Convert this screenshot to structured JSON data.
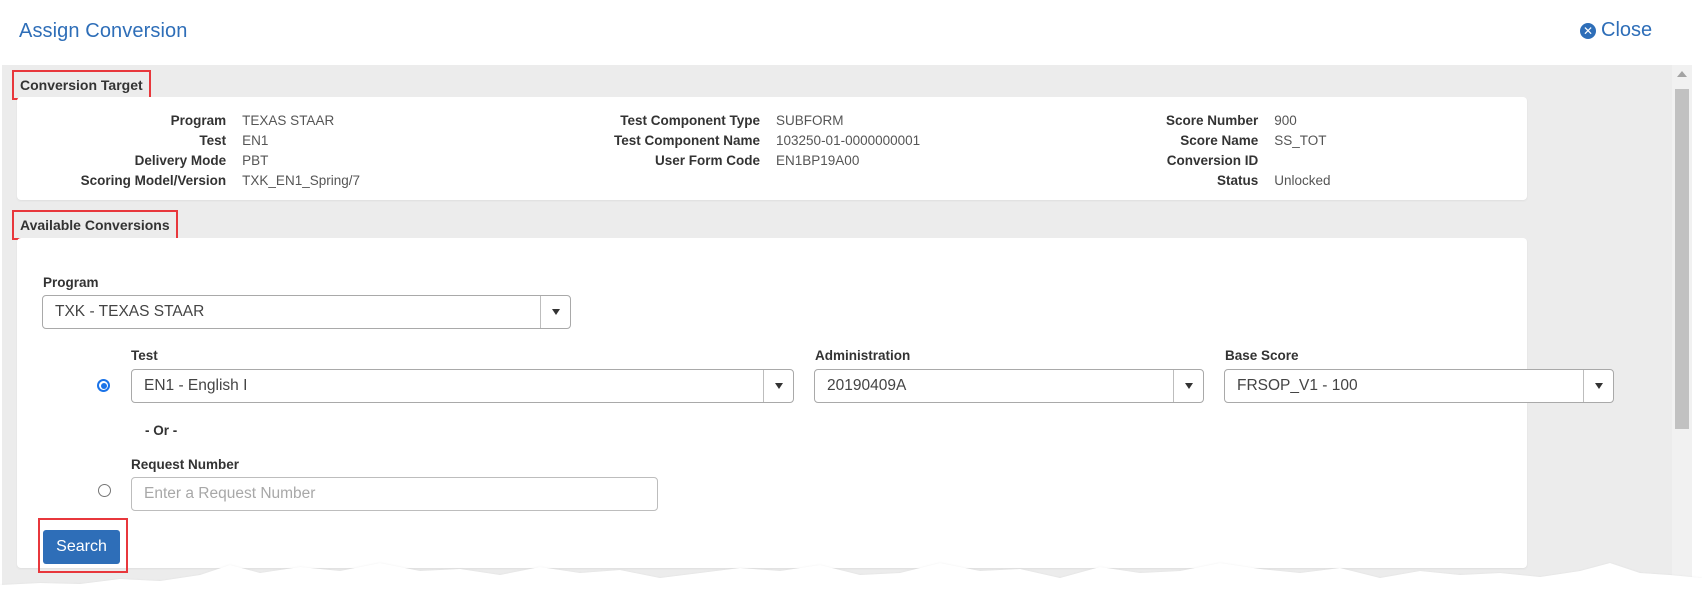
{
  "header": {
    "title": "Assign Conversion",
    "close_label": "Close",
    "close_icon": "circle-x-icon"
  },
  "colors": {
    "accent": "#2e6eb8",
    "highlight": "#e8373c",
    "panel_bg": "#ececec"
  },
  "conversion_target": {
    "heading": "Conversion Target",
    "columns": [
      [
        {
          "label": "Program",
          "value": "TEXAS STAAR"
        },
        {
          "label": "Test",
          "value": "EN1"
        },
        {
          "label": "Delivery Mode",
          "value": "PBT"
        },
        {
          "label": "Scoring Model/Version",
          "value": "TXK_EN1_Spring/7"
        }
      ],
      [
        {
          "label": "Test Component Type",
          "value": "SUBFORM"
        },
        {
          "label": "Test Component Name",
          "value": "103250-01-0000000001"
        },
        {
          "label": "User Form Code",
          "value": "EN1BP19A00"
        }
      ],
      [
        {
          "label": "Score Number",
          "value": "900"
        },
        {
          "label": "Score Name",
          "value": "SS_TOT"
        },
        {
          "label": "Conversion ID",
          "value": ""
        },
        {
          "label": "Status",
          "value": "Unlocked"
        }
      ]
    ]
  },
  "available_conversions": {
    "heading": "Available Conversions",
    "program": {
      "label": "Program",
      "value": "TXK - TEXAS STAAR"
    },
    "test": {
      "label": "Test",
      "value": "EN1 - English I",
      "selected": true
    },
    "administration": {
      "label": "Administration",
      "value": "20190409A"
    },
    "base_score": {
      "label": "Base Score",
      "value": "FRSOP_V1 - 100"
    },
    "or_text": "- Or -",
    "request_number": {
      "label": "Request Number",
      "value": "",
      "placeholder": "Enter a Request Number",
      "selected": false
    },
    "search_label": "Search"
  }
}
